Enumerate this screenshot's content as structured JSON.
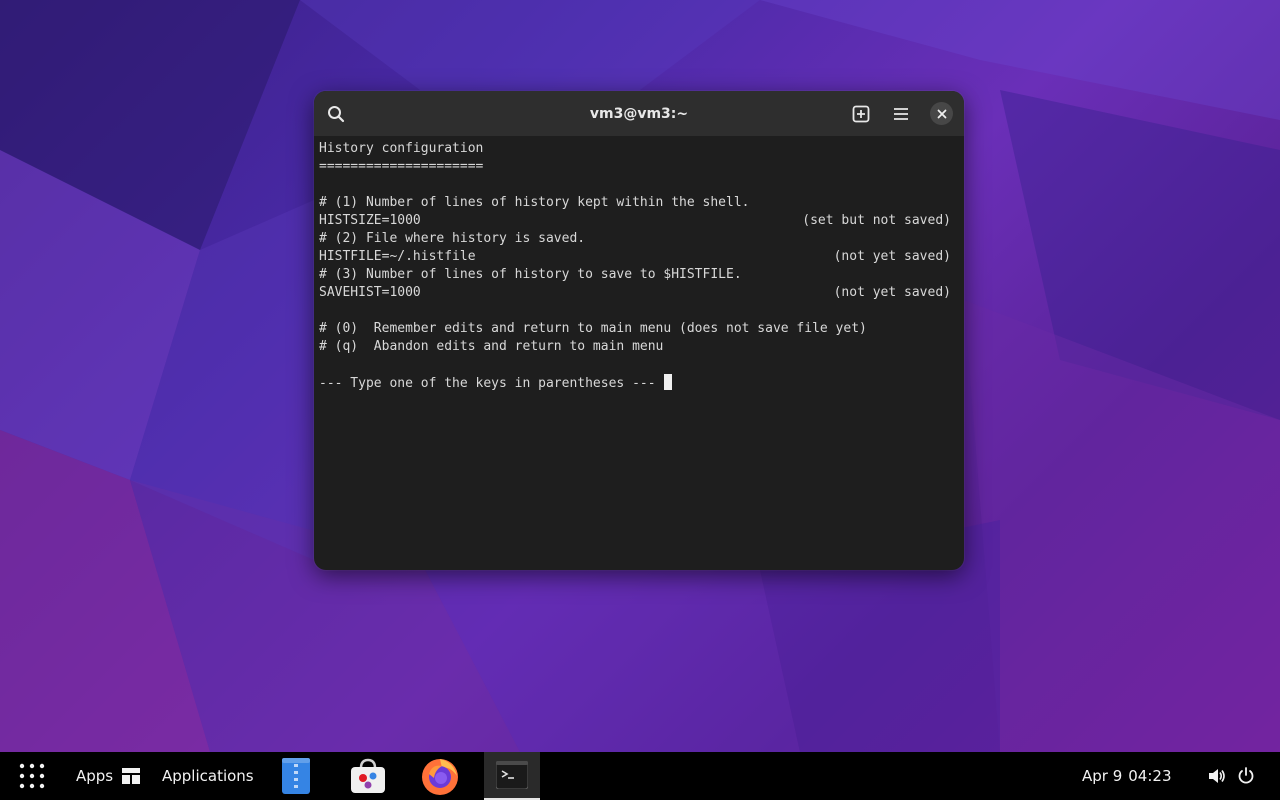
{
  "window": {
    "title": "vm3@vm3:~",
    "search_icon": "search-icon",
    "new_tab_icon": "new-tab-icon",
    "menu_icon": "hamburger-menu-icon",
    "close_icon": "close-icon"
  },
  "terminal": {
    "lines": [
      {
        "left": "History configuration",
        "right": ""
      },
      {
        "left": "=====================",
        "right": ""
      },
      {
        "left": "",
        "right": ""
      },
      {
        "left": "# (1) Number of lines of history kept within the shell.",
        "right": ""
      },
      {
        "left": "HISTSIZE=1000",
        "right": "(set but not saved)"
      },
      {
        "left": "# (2) File where history is saved.",
        "right": ""
      },
      {
        "left": "HISTFILE=~/.histfile",
        "right": "(not yet saved)"
      },
      {
        "left": "# (3) Number of lines of history to save to $HISTFILE.",
        "right": ""
      },
      {
        "left": "SAVEHIST=1000",
        "right": "(not yet saved)"
      },
      {
        "left": "",
        "right": ""
      },
      {
        "left": "# (0)  Remember edits and return to main menu (does not save file yet)",
        "right": ""
      },
      {
        "left": "# (q)  Abandon edits and return to main menu",
        "right": ""
      },
      {
        "left": "",
        "right": ""
      }
    ],
    "prompt": "--- Type one of the keys in parentheses ---"
  },
  "taskbar": {
    "apps_label": "Apps",
    "applications_label": "Applications",
    "date": "Apr 9",
    "time": "04:23",
    "dock": [
      "files-icon",
      "software-store-icon",
      "firefox-icon",
      "terminal-icon"
    ]
  },
  "colors": {
    "terminal_bg": "#1e1e1e",
    "headerbar_bg": "#2e2e2e",
    "taskbar_bg": "#000000",
    "wallpaper_accent": "#4a2aa8"
  }
}
